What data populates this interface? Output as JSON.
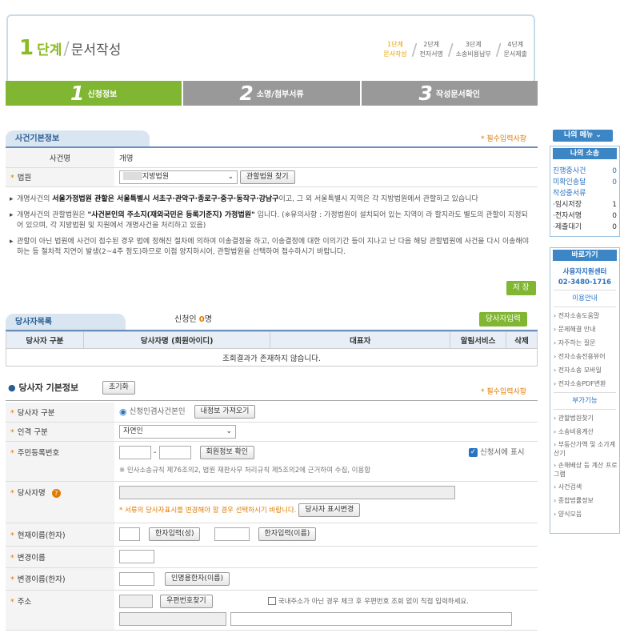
{
  "header": {
    "step_num": "1",
    "step_word": "단계",
    "title": "문서작성",
    "steps": [
      {
        "line1": "1단계",
        "line2": "문서작성",
        "active": true
      },
      {
        "line1": "2단계",
        "line2": "전자서명",
        "active": false
      },
      {
        "line1": "3단계",
        "line2": "소송비용납부",
        "active": false
      },
      {
        "line1": "4단계",
        "line2": "문서제출",
        "active": false
      }
    ]
  },
  "tabs": [
    {
      "num": "1",
      "label": "신청정보"
    },
    {
      "num": "2",
      "label": "소명/첨부서류"
    },
    {
      "num": "3",
      "label": "작성문서확인"
    }
  ],
  "case_section": {
    "title": "사건기본정보",
    "required_note": "* 필수입력사항",
    "case_name_label": "사건명",
    "case_name_value": "개명",
    "court_label": "법원",
    "court_value": "지방법원",
    "court_find_button": "관할법원 찾기",
    "note1_a": "개명사건의 ",
    "note1_b": "서울가정법원 관할은 서울특별시 서초구·관악구·종로구·중구·동작구·강남구",
    "note1_c": "이고, 그 외 서울특별시 지역은 각 지방법원에서 관할하고 있습니다",
    "note2_a": "개명사건의 관할법원은 ",
    "note2_b": "\"사건본인의 주소지(재외국민은 등록기준지) 가정법원\"",
    "note2_c": " 입니다. (※유의사항 : 가정법원이 설치되어 있는 지역이 라 할지라도 별도의 관할이 지정되어 있으며, 각 지방법원 및 지원에서 개명사건을 처리하고 있음)",
    "note3": "관할이 아닌 법원에 사건이 접수된 경우 법에 정해진 절차에 의하여 이송결정을 하고, 이송결정에 대한 이의기간 등이 지나고 난 다음 해당 관할법원에 사건을 다시 이송해야 하는 등 절차적 지연이 발생(2~4주 정도)하므로 이점 양지하시어, 관할법원을 선택하여 접수하시기 바랍니다.",
    "save_button": "저 장"
  },
  "party_list": {
    "title": "당사자목록",
    "applicant_label": "신청인 ",
    "applicant_count": "0",
    "applicant_unit": "명",
    "add_button": "당사자입력",
    "columns": [
      "당사자 구분",
      "당사자명 (회원아이디)",
      "대표자",
      "알림서비스",
      "삭제"
    ],
    "empty_message": "조회결과가 존재하지 않습니다."
  },
  "party_info": {
    "title": "당사자 기본정보",
    "reset_button": "초기화",
    "required_note": "* 필수입력사항",
    "type_label": "당사자 구분",
    "type_radio": "신청인겸사건본인",
    "import_button": "내정보 가져오기",
    "person_type_label": "인격 구분",
    "person_type_value": "자연인",
    "rrn_label": "주민등록번호",
    "rrn_dash": "-",
    "member_check_button": "회원정보 확인",
    "display_on_app": "신청서에 표시",
    "rrn_note": "※ 민사소송규칙 제76조의2, 법원 재판사무 처리규칙 제5조의2에 근거하여 수집, 이용함",
    "party_name_label": "당사자명",
    "party_name_note": "* 서류의 당사자표시를 변경해야 할 경우 선택하시기 바랍니다.",
    "party_name_button": "당사자 표시변경",
    "current_name_label": "현재이름(한자)",
    "hanja_surname_button": "한자입력(성)",
    "hanja_name_button": "한자입력(이름)",
    "changed_name_label": "변경이름",
    "changed_name_hanja_label": "변경이름(한자)",
    "personal_hanja_button": "인명용한자(이름)",
    "address_label": "주소",
    "postcode_button": "우편번호찾기",
    "foreign_address_note": "국내주소가 아닌 경우 체크 후 우편번호 조회 없이 직접 입력하세요."
  },
  "sidebar": {
    "menu_button": "나의 메뉴 ⌄",
    "my_case_title": "나의 소송",
    "case_rows": [
      {
        "label": "진행중사건",
        "count": "0",
        "blue": true
      },
      {
        "label": "미확인송달",
        "count": "0",
        "blue": true
      },
      {
        "label": "작성중서류",
        "count": "",
        "blue": true
      },
      {
        "label": "·임시저장",
        "count": "1",
        "blue": false
      },
      {
        "label": "·전자서명",
        "count": "0",
        "blue": false
      },
      {
        "label": "·제출대기",
        "count": "0",
        "blue": false
      }
    ],
    "shortcut_title": "바로가기",
    "support_center": "사용자지원센터",
    "support_phone": "02-3480-1716",
    "usage_guide": "이용안내",
    "usage_links": [
      "전자소송도움말",
      "문제해결 안내",
      "자주하는 질문",
      "전자소송전용뷰어",
      "전자소송 모바일",
      "전자소송PDF변환"
    ],
    "extra_title": "부가기능",
    "extra_links": [
      "관할법원찾기",
      "소송비용계산",
      "부동산가액 및 소가계산기",
      "손해배상 등 계산 프로그램",
      "사건검색",
      "종합법률정보",
      "양식모음"
    ]
  }
}
